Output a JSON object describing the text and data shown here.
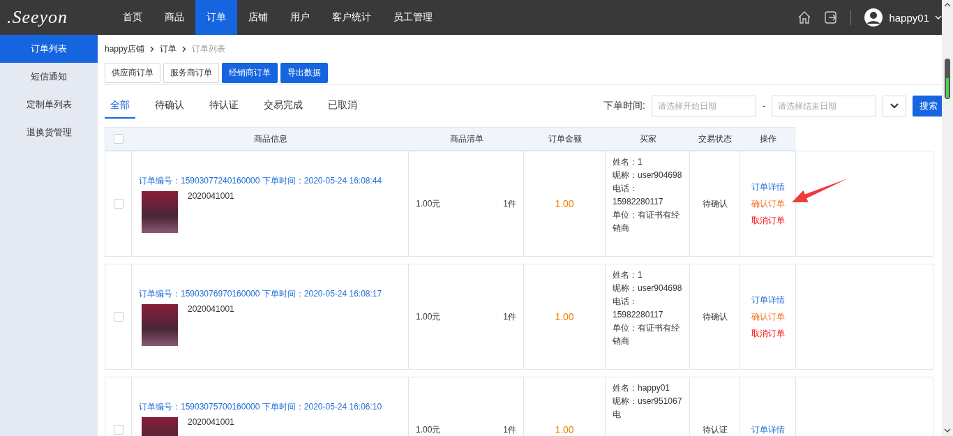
{
  "nav": {
    "logo": ".Seeyon",
    "items": [
      {
        "label": "首页",
        "selected": false
      },
      {
        "label": "商品",
        "selected": false
      },
      {
        "label": "订单",
        "selected": true
      },
      {
        "label": "店铺",
        "selected": false
      },
      {
        "label": "用户",
        "selected": false
      },
      {
        "label": "客户统计",
        "selected": false
      },
      {
        "label": "员工管理",
        "selected": false
      }
    ],
    "user": "happy01"
  },
  "sidebar": {
    "items": [
      {
        "label": "订单列表",
        "selected": true
      },
      {
        "label": "短信通知",
        "selected": false
      },
      {
        "label": "定制单列表",
        "selected": false
      },
      {
        "label": "退换货管理",
        "selected": false
      }
    ]
  },
  "breadcrumb": [
    "happy店铺",
    "订单",
    "订单列表"
  ],
  "order_types": [
    {
      "label": "供应商订单",
      "selected": false
    },
    {
      "label": "服务商订单",
      "selected": false
    },
    {
      "label": "经销商订单",
      "selected": true
    },
    {
      "label": "导出数据",
      "selected": true
    }
  ],
  "status_tabs": [
    {
      "label": "全部",
      "selected": true
    },
    {
      "label": "待确认",
      "selected": false
    },
    {
      "label": "待认证",
      "selected": false
    },
    {
      "label": "交易完成",
      "selected": false
    },
    {
      "label": "已取消",
      "selected": false
    }
  ],
  "filter": {
    "label": "下单时间:",
    "start_placeholder": "请选择开始日期",
    "separator": "-",
    "end_placeholder": "请选择结束日期",
    "search": "搜索"
  },
  "table": {
    "select_all_checked": false,
    "columns": [
      "商品信息",
      "商品清单",
      "订单金额",
      "买家",
      "交易状态",
      "操作"
    ],
    "rows": [
      {
        "checked": false,
        "order_line": "订单编号：15903077240160000 下单时间：2020-05-24 16:08:44",
        "product_code": "2020041001",
        "price": "1.00元",
        "quantity": "1件",
        "amount": "1.00",
        "buyer": [
          "姓名：1",
          "昵称：user904698",
          "电话：15982280117",
          "单位：有证书有经销商"
        ],
        "status": "待确认",
        "actions": [
          {
            "label": "订单详情",
            "kind": "detail"
          },
          {
            "label": "确认订单",
            "kind": "confirm"
          },
          {
            "label": "取消订单",
            "kind": "cancel"
          }
        ]
      },
      {
        "checked": false,
        "order_line": "订单编号：15903076970160000 下单时间：2020-05-24 16:08:17",
        "product_code": "2020041001",
        "price": "1.00元",
        "quantity": "1件",
        "amount": "1.00",
        "buyer": [
          "姓名：1",
          "昵称：user904698",
          "电话：15982280117",
          "单位：有证书有经销商"
        ],
        "status": "待确认",
        "actions": [
          {
            "label": "订单详情",
            "kind": "detail"
          },
          {
            "label": "确认订单",
            "kind": "confirm"
          },
          {
            "label": "取消订单",
            "kind": "cancel"
          }
        ]
      },
      {
        "checked": false,
        "order_line": "订单编号：15903075700160000 下单时间：2020-05-24 16:06:10",
        "product_code": "2020041001",
        "price": "1.00元",
        "quantity": "1件",
        "amount": "1.00",
        "buyer": [
          "姓名：happy01",
          "昵称：user951067",
          "电"
        ],
        "status": "待认证",
        "actions": [
          {
            "label": "订单详情",
            "kind": "detail"
          }
        ]
      }
    ]
  }
}
